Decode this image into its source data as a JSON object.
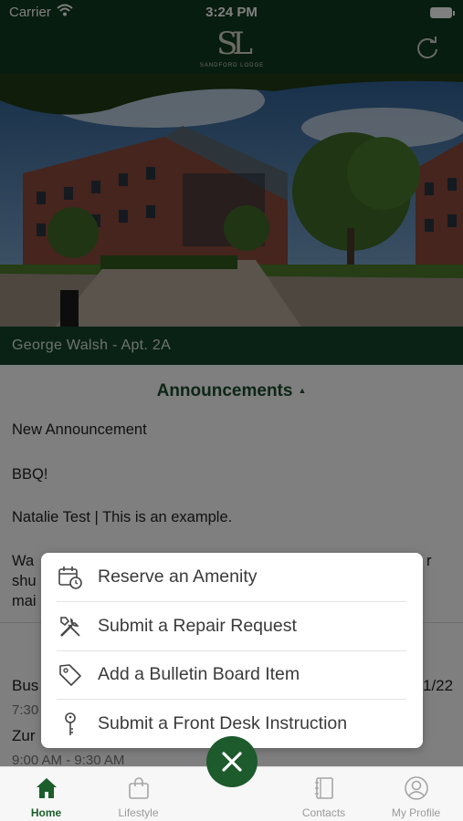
{
  "status_bar": {
    "carrier": "Carrier",
    "time": "3:24 PM"
  },
  "header": {
    "logo_mark": "SL",
    "logo_subtitle": "SANDFORD LODGE",
    "refresh_icon": "refresh-icon"
  },
  "resident": {
    "label": "George Walsh - Apt. 2A"
  },
  "announcements": {
    "title": "Announcements",
    "items": [
      "New Announcement",
      "BBQ!",
      "Natalie Test | This is an example.",
      "Wa",
      "shu",
      "mai"
    ],
    "right_fragment": "r"
  },
  "calendar_fragments": {
    "item1_title": "Bus",
    "item1_time": "7:30",
    "item1_date": "1/22",
    "item2_title": "Zur",
    "item2_time": "9:00 AM - 9:30 AM"
  },
  "quick_menu": {
    "items": [
      {
        "label": "Reserve an Amenity",
        "icon": "calendar-clock-icon"
      },
      {
        "label": "Submit a Repair Request",
        "icon": "tools-icon"
      },
      {
        "label": "Add a Bulletin Board Item",
        "icon": "tag-icon"
      },
      {
        "label": "Submit a Front Desk Instruction",
        "icon": "key-icon"
      }
    ]
  },
  "tabbar": {
    "tabs": [
      {
        "label": "Home",
        "icon": "home-icon",
        "active": true
      },
      {
        "label": "Lifestyle",
        "icon": "shopping-bag-icon",
        "active": false
      },
      {
        "label": "Contacts",
        "icon": "notebook-icon",
        "active": false
      },
      {
        "label": "My Profile",
        "icon": "user-circle-icon",
        "active": false
      }
    ],
    "center_button_icon": "close-icon"
  },
  "colors": {
    "brand_green": "#1d5a2c",
    "header_green": "#0f3a1e",
    "resident_bar": "#14452a"
  }
}
